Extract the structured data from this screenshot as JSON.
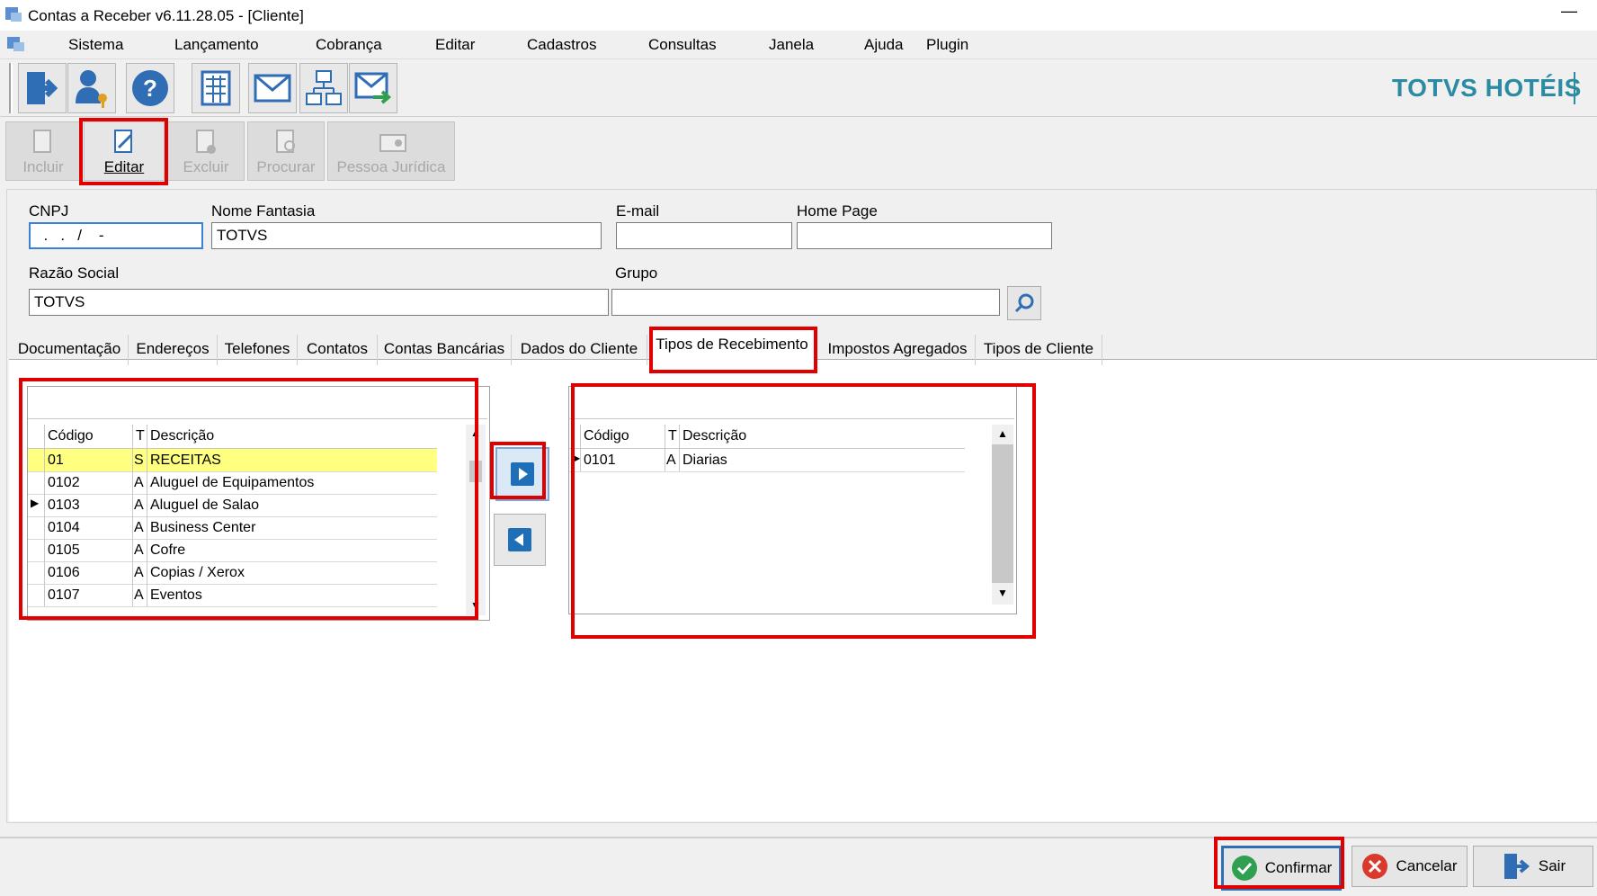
{
  "window": {
    "title": "Contas a Receber v6.11.28.05 - [Cliente]",
    "minimize": "—"
  },
  "menu": [
    "Sistema",
    "Lançamento",
    "Cobrança",
    "Editar",
    "Cadastros",
    "Consultas",
    "Janela",
    "Ajuda",
    "Plugin"
  ],
  "toolbar_icons": [
    "exit-icon",
    "user-key-icon",
    "help-icon",
    "calculator-icon",
    "email-icon",
    "network-icon",
    "email-send-icon"
  ],
  "brand": "TOTVS HOTÉIS",
  "actions": {
    "incluir": "Incluir",
    "editar": "Editar",
    "excluir": "Excluir",
    "procurar": "Procurar",
    "pessoa_juridica": "Pessoa Jurídica"
  },
  "form": {
    "cnpj_label": "CNPJ",
    "cnpj_value": "  .   .   /    -",
    "nome_fantasia_label": "Nome Fantasia",
    "nome_fantasia_value": "TOTVS",
    "email_label": "E-mail",
    "email_value": "",
    "home_page_label": "Home Page",
    "home_page_value": "",
    "razao_social_label": "Razão Social",
    "razao_social_value": "TOTVS",
    "grupo_label": "Grupo",
    "grupo_value": ""
  },
  "tabs": [
    "Documentação",
    "Endereços",
    "Telefones",
    "Contatos",
    "Contas Bancárias",
    "Dados do Cliente",
    "Tipos de Recebimento",
    "Impostos Agregados",
    "Tipos de Cliente"
  ],
  "active_tab": "Tipos de Recebimento",
  "left_grid": {
    "headers": {
      "codigo": "Código",
      "t": "T",
      "descricao": "Descrição"
    },
    "rows": [
      {
        "codigo": "01",
        "t": "S",
        "descricao": "RECEITAS",
        "selected": true
      },
      {
        "codigo": "0102",
        "t": "A",
        "descricao": "Aluguel de Equipamentos"
      },
      {
        "codigo": "0103",
        "t": "A",
        "descricao": "Aluguel de Salao",
        "current": true
      },
      {
        "codigo": "0104",
        "t": "A",
        "descricao": "Business Center"
      },
      {
        "codigo": "0105",
        "t": "A",
        "descricao": "Cofre"
      },
      {
        "codigo": "0106",
        "t": "A",
        "descricao": "Copias / Xerox"
      },
      {
        "codigo": "0107",
        "t": "A",
        "descricao": "Eventos"
      }
    ]
  },
  "right_grid": {
    "headers": {
      "codigo": "Código",
      "t": "T",
      "descricao": "Descrição"
    },
    "rows": [
      {
        "codigo": "0101",
        "t": "A",
        "descricao": "Diarias",
        "current": true
      }
    ]
  },
  "footer": {
    "confirmar": "Confirmar",
    "cancelar": "Cancelar",
    "sair": "Sair"
  },
  "colors": {
    "highlight": "#e00000",
    "selected_row": "#ffff80",
    "brand": "#2a8ba3",
    "arrow_blue": "#1e6fb8"
  }
}
